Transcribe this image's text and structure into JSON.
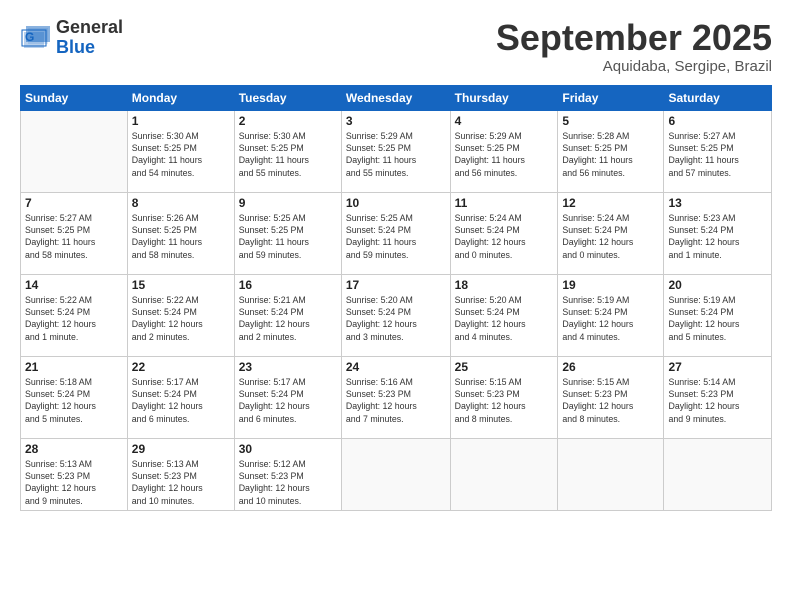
{
  "logo": {
    "general": "General",
    "blue": "Blue"
  },
  "header": {
    "title": "September 2025",
    "subtitle": "Aquidaba, Sergipe, Brazil"
  },
  "weekdays": [
    "Sunday",
    "Monday",
    "Tuesday",
    "Wednesday",
    "Thursday",
    "Friday",
    "Saturday"
  ],
  "weeks": [
    [
      {
        "day": "",
        "info": ""
      },
      {
        "day": "1",
        "info": "Sunrise: 5:30 AM\nSunset: 5:25 PM\nDaylight: 11 hours\nand 54 minutes."
      },
      {
        "day": "2",
        "info": "Sunrise: 5:30 AM\nSunset: 5:25 PM\nDaylight: 11 hours\nand 55 minutes."
      },
      {
        "day": "3",
        "info": "Sunrise: 5:29 AM\nSunset: 5:25 PM\nDaylight: 11 hours\nand 55 minutes."
      },
      {
        "day": "4",
        "info": "Sunrise: 5:29 AM\nSunset: 5:25 PM\nDaylight: 11 hours\nand 56 minutes."
      },
      {
        "day": "5",
        "info": "Sunrise: 5:28 AM\nSunset: 5:25 PM\nDaylight: 11 hours\nand 56 minutes."
      },
      {
        "day": "6",
        "info": "Sunrise: 5:27 AM\nSunset: 5:25 PM\nDaylight: 11 hours\nand 57 minutes."
      }
    ],
    [
      {
        "day": "7",
        "info": "Sunrise: 5:27 AM\nSunset: 5:25 PM\nDaylight: 11 hours\nand 58 minutes."
      },
      {
        "day": "8",
        "info": "Sunrise: 5:26 AM\nSunset: 5:25 PM\nDaylight: 11 hours\nand 58 minutes."
      },
      {
        "day": "9",
        "info": "Sunrise: 5:25 AM\nSunset: 5:25 PM\nDaylight: 11 hours\nand 59 minutes."
      },
      {
        "day": "10",
        "info": "Sunrise: 5:25 AM\nSunset: 5:24 PM\nDaylight: 11 hours\nand 59 minutes."
      },
      {
        "day": "11",
        "info": "Sunrise: 5:24 AM\nSunset: 5:24 PM\nDaylight: 12 hours\nand 0 minutes."
      },
      {
        "day": "12",
        "info": "Sunrise: 5:24 AM\nSunset: 5:24 PM\nDaylight: 12 hours\nand 0 minutes."
      },
      {
        "day": "13",
        "info": "Sunrise: 5:23 AM\nSunset: 5:24 PM\nDaylight: 12 hours\nand 1 minute."
      }
    ],
    [
      {
        "day": "14",
        "info": "Sunrise: 5:22 AM\nSunset: 5:24 PM\nDaylight: 12 hours\nand 1 minute."
      },
      {
        "day": "15",
        "info": "Sunrise: 5:22 AM\nSunset: 5:24 PM\nDaylight: 12 hours\nand 2 minutes."
      },
      {
        "day": "16",
        "info": "Sunrise: 5:21 AM\nSunset: 5:24 PM\nDaylight: 12 hours\nand 2 minutes."
      },
      {
        "day": "17",
        "info": "Sunrise: 5:20 AM\nSunset: 5:24 PM\nDaylight: 12 hours\nand 3 minutes."
      },
      {
        "day": "18",
        "info": "Sunrise: 5:20 AM\nSunset: 5:24 PM\nDaylight: 12 hours\nand 4 minutes."
      },
      {
        "day": "19",
        "info": "Sunrise: 5:19 AM\nSunset: 5:24 PM\nDaylight: 12 hours\nand 4 minutes."
      },
      {
        "day": "20",
        "info": "Sunrise: 5:19 AM\nSunset: 5:24 PM\nDaylight: 12 hours\nand 5 minutes."
      }
    ],
    [
      {
        "day": "21",
        "info": "Sunrise: 5:18 AM\nSunset: 5:24 PM\nDaylight: 12 hours\nand 5 minutes."
      },
      {
        "day": "22",
        "info": "Sunrise: 5:17 AM\nSunset: 5:24 PM\nDaylight: 12 hours\nand 6 minutes."
      },
      {
        "day": "23",
        "info": "Sunrise: 5:17 AM\nSunset: 5:24 PM\nDaylight: 12 hours\nand 6 minutes."
      },
      {
        "day": "24",
        "info": "Sunrise: 5:16 AM\nSunset: 5:23 PM\nDaylight: 12 hours\nand 7 minutes."
      },
      {
        "day": "25",
        "info": "Sunrise: 5:15 AM\nSunset: 5:23 PM\nDaylight: 12 hours\nand 8 minutes."
      },
      {
        "day": "26",
        "info": "Sunrise: 5:15 AM\nSunset: 5:23 PM\nDaylight: 12 hours\nand 8 minutes."
      },
      {
        "day": "27",
        "info": "Sunrise: 5:14 AM\nSunset: 5:23 PM\nDaylight: 12 hours\nand 9 minutes."
      }
    ],
    [
      {
        "day": "28",
        "info": "Sunrise: 5:13 AM\nSunset: 5:23 PM\nDaylight: 12 hours\nand 9 minutes."
      },
      {
        "day": "29",
        "info": "Sunrise: 5:13 AM\nSunset: 5:23 PM\nDaylight: 12 hours\nand 10 minutes."
      },
      {
        "day": "30",
        "info": "Sunrise: 5:12 AM\nSunset: 5:23 PM\nDaylight: 12 hours\nand 10 minutes."
      },
      {
        "day": "",
        "info": ""
      },
      {
        "day": "",
        "info": ""
      },
      {
        "day": "",
        "info": ""
      },
      {
        "day": "",
        "info": ""
      }
    ]
  ]
}
